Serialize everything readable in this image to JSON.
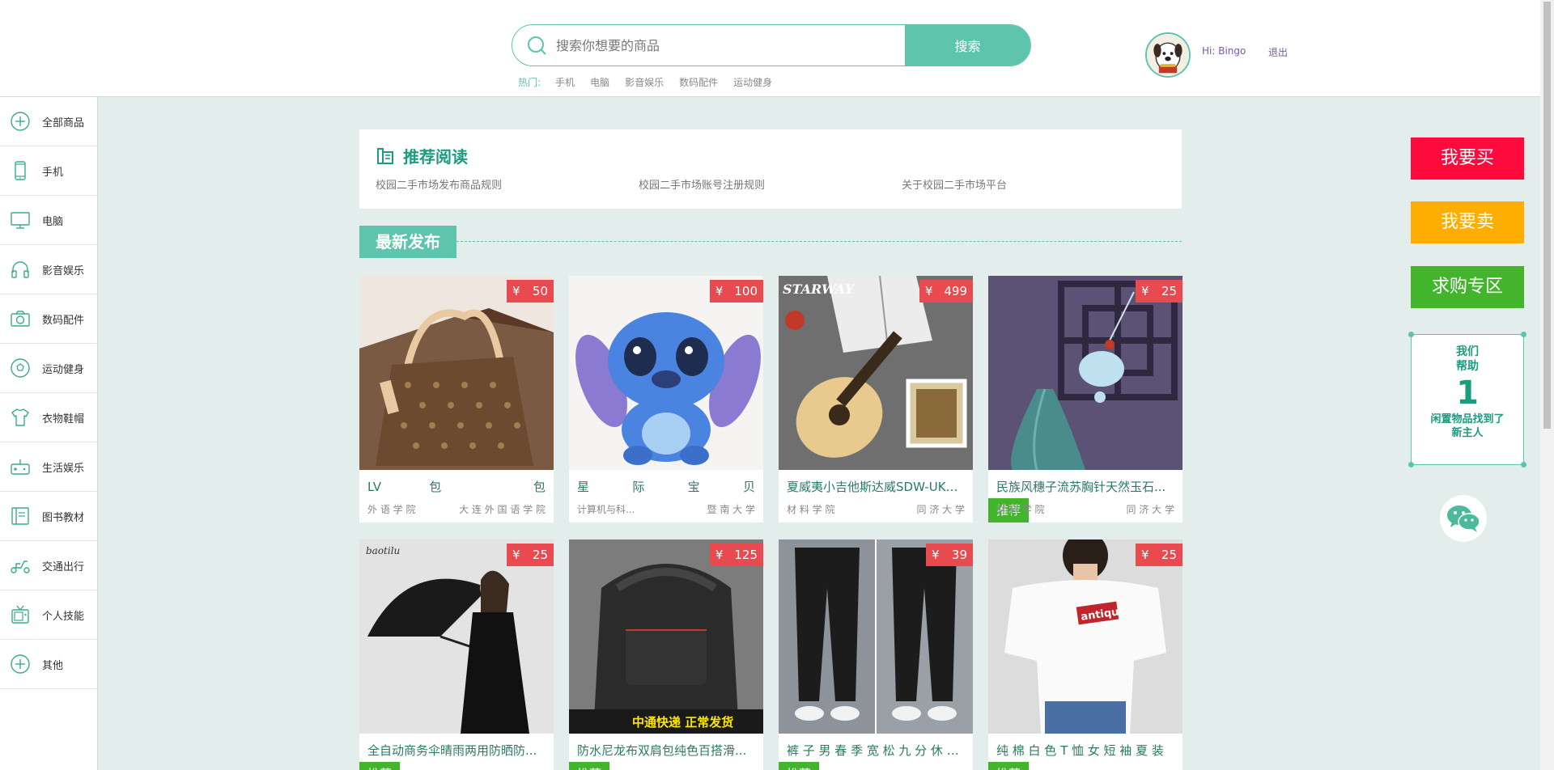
{
  "header": {
    "search_placeholder": "搜索你想要的商品",
    "search_button": "搜索",
    "hot_label": "热门:",
    "hot_links": [
      "手机",
      "电脑",
      "影音娱乐",
      "数码配件",
      "运动健身"
    ],
    "user_greeting": "Hi: Bingo",
    "logout": "退出"
  },
  "sidebar": {
    "items": [
      {
        "label": "全部商品",
        "icon": "plus-circle-icon"
      },
      {
        "label": "手机",
        "icon": "phone-icon"
      },
      {
        "label": "电脑",
        "icon": "monitor-icon"
      },
      {
        "label": "影音娱乐",
        "icon": "headphones-icon"
      },
      {
        "label": "数码配件",
        "icon": "camera-icon"
      },
      {
        "label": "运动健身",
        "icon": "football-icon"
      },
      {
        "label": "衣物鞋帽",
        "icon": "tshirt-icon"
      },
      {
        "label": "生活娱乐",
        "icon": "gamepad-icon"
      },
      {
        "label": "图书教材",
        "icon": "book-icon"
      },
      {
        "label": "交通出行",
        "icon": "scooter-icon"
      },
      {
        "label": "个人技能",
        "icon": "tv-icon"
      },
      {
        "label": "其他",
        "icon": "plus-circle-icon"
      }
    ]
  },
  "recommend": {
    "title": "推荐阅读",
    "links": [
      "校园二手市场发布商品规则",
      "校园二手市场账号注册规则",
      "关于校园二手市场平台"
    ]
  },
  "latest": {
    "label": "最新发布"
  },
  "products": [
    {
      "title": "LV 包 包",
      "price": "50",
      "recommended": false,
      "meta": [
        "外 语 学 院",
        "大 连 外 国 语 学 院"
      ]
    },
    {
      "title": "星 际 宝 贝",
      "price": "100",
      "recommended": false,
      "meta": [
        "计算机与科...",
        "暨 南 大 学"
      ]
    },
    {
      "title": "夏威夷小吉他斯达威SDW-UK2...",
      "price": "499",
      "recommended": false,
      "meta": [
        "材 料 学 院",
        "同 济 大 学"
      ]
    },
    {
      "title": "民族风穗子流苏胸针天然玉石...",
      "price": "25",
      "recommended": true,
      "meta": [
        "材 料 学 院",
        "同 济 大 学"
      ]
    },
    {
      "title": "全自动商务伞晴雨两用防晒防...",
      "price": "25",
      "recommended": true,
      "meta": [
        "",
        ""
      ]
    },
    {
      "title": "防水尼龙布双肩包纯色百搭滑...",
      "price": "125",
      "recommended": true,
      "meta": [
        "",
        ""
      ]
    },
    {
      "title": "裤 子 男 春 季 宽 松 九 分 休 闲 裤",
      "price": "39",
      "recommended": true,
      "meta": [
        "",
        ""
      ]
    },
    {
      "title": "纯 棉 白 色 T 恤 女 短 袖 夏 装",
      "price": "25",
      "recommended": true,
      "meta": [
        "",
        ""
      ]
    }
  ],
  "currency": "¥",
  "recommended_tag": "推荐",
  "image_overlay_text": {
    "backpack_banner": "中通快递 正常发货",
    "tshirt_logo": "antique",
    "guitar_brand": "STARWAY",
    "umbrella_brand": "baotilu"
  },
  "right_float": {
    "buy": "我要买",
    "sell": "我要卖",
    "wanted": "求购专区",
    "help_title_1": "我们",
    "help_title_2": "帮助",
    "help_num": "1",
    "help_desc_1": "闲置物品找到了",
    "help_desc_2": "新主人"
  },
  "colors": {
    "accent": "#5ec4ad",
    "price": "#e94a4f",
    "recommended": "#43b52d",
    "buy": "#ff0a3c",
    "sell": "#ffae00",
    "wanted": "#43b52d"
  }
}
